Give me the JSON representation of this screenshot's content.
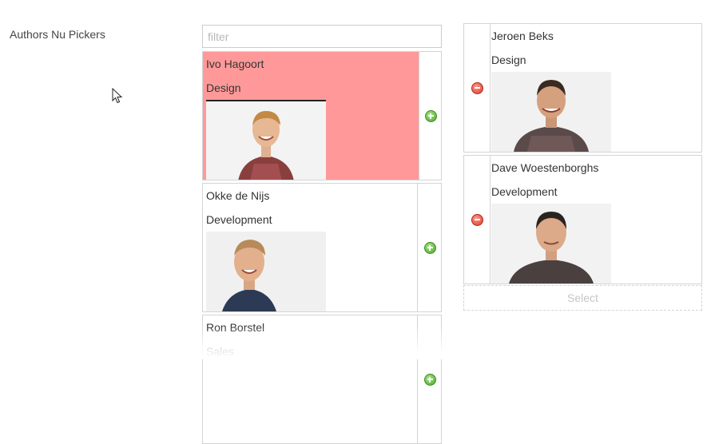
{
  "property": {
    "label": "Authors Nu Pickers"
  },
  "filter": {
    "placeholder": "filter",
    "value": ""
  },
  "colors": {
    "highlight": "#ff9999",
    "add": "#4aa52a",
    "remove": "#d63b2b",
    "border": "#d4d4d4"
  },
  "available_items": [
    {
      "name": "Ivo Hagoort",
      "department": "Design",
      "photo": "portrait-photo",
      "action_icon": "add-icon",
      "highlighted": true
    },
    {
      "name": "Okke de Nijs",
      "department": "Development",
      "photo": "portrait-photo",
      "action_icon": "add-icon",
      "highlighted": false
    },
    {
      "name": "Ron Borstel",
      "department": "Sales",
      "photo": "portrait-photo",
      "action_icon": "add-icon",
      "highlighted": false
    }
  ],
  "selected_items": [
    {
      "name": "Jeroen Beks",
      "department": "Design",
      "photo": "portrait-photo",
      "action_icon": "remove-icon"
    },
    {
      "name": "Dave Woestenborghs",
      "department": "Development",
      "photo": "portrait-photo",
      "action_icon": "remove-icon"
    }
  ],
  "select_button": {
    "label": "Select"
  }
}
